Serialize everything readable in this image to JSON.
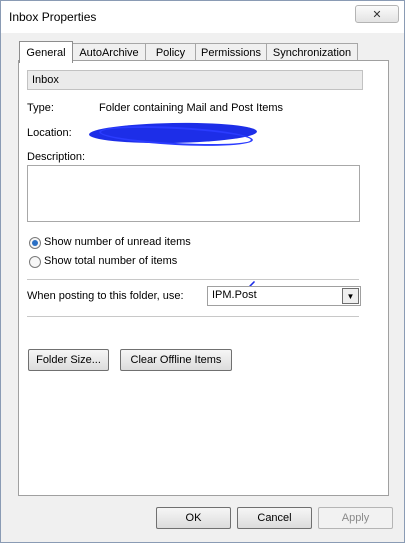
{
  "window": {
    "title": "Inbox Properties",
    "close_label": "✕"
  },
  "tabs": [
    {
      "label": "General",
      "active": true
    },
    {
      "label": "AutoArchive",
      "active": false
    },
    {
      "label": "Policy",
      "active": false
    },
    {
      "label": "Permissions",
      "active": false
    },
    {
      "label": "Synchronization",
      "active": false
    }
  ],
  "general": {
    "folder_name": "Inbox",
    "type_label": "Type:",
    "type_value": "Folder containing Mail and Post Items",
    "location_label": "Location:",
    "description_label": "Description:",
    "description_value": "",
    "radio_unread_label": "Show number of unread items",
    "radio_unread_checked": true,
    "radio_total_label": "Show total number of items",
    "radio_total_checked": false,
    "posting_label": "When posting to this folder, use:",
    "posting_value": "IPM.Post",
    "folder_size_button": "Folder Size...",
    "clear_offline_button": "Clear Offline Items"
  },
  "footer": {
    "ok_label": "OK",
    "cancel_label": "Cancel",
    "apply_label": "Apply"
  },
  "colors": {
    "accent": "#2a6fc4",
    "redaction": "#1d2ee8"
  }
}
